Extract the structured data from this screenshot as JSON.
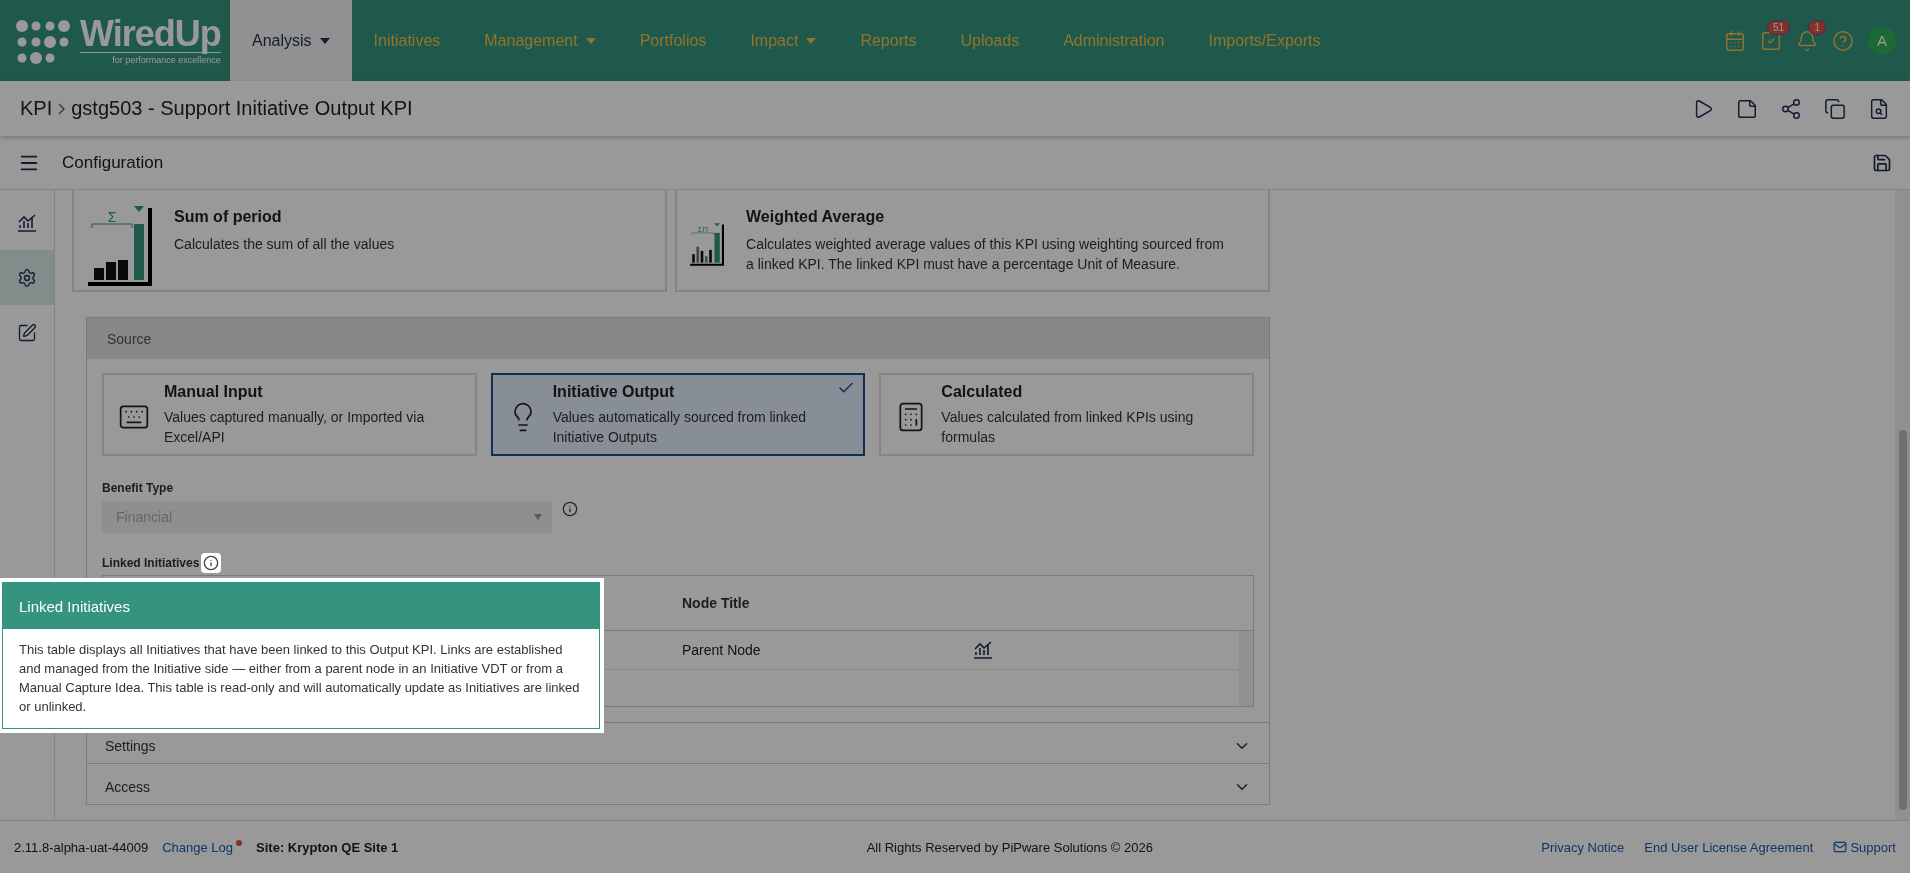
{
  "logo": {
    "name": "WiredUp",
    "tagline": "for performance excellence"
  },
  "nav": [
    {
      "label": "Analysis",
      "selected": true,
      "dropdown": true
    },
    {
      "label": "Initiatives",
      "selected": false,
      "dropdown": false
    },
    {
      "label": "Management",
      "selected": false,
      "dropdown": true
    },
    {
      "label": "Portfolios",
      "selected": false,
      "dropdown": false
    },
    {
      "label": "Impact",
      "selected": false,
      "dropdown": true
    },
    {
      "label": "Reports",
      "selected": false,
      "dropdown": false
    },
    {
      "label": "Uploads",
      "selected": false,
      "dropdown": false
    },
    {
      "label": "Administration",
      "selected": false,
      "dropdown": false
    },
    {
      "label": "Imports/Exports",
      "selected": false,
      "dropdown": false
    }
  ],
  "header_actions": [
    {
      "kind": "calendar"
    },
    {
      "kind": "tasks",
      "badge": "51"
    },
    {
      "kind": "bell",
      "badge": "1"
    },
    {
      "kind": "help"
    }
  ],
  "avatar": "A",
  "breadcrumb": [
    "KPI",
    "gstg503 - Support Initiative Output KPI"
  ],
  "page_actions": [
    {
      "kind": "play"
    },
    {
      "kind": "note"
    },
    {
      "kind": "network"
    },
    {
      "kind": "copy"
    },
    {
      "kind": "search"
    }
  ],
  "section_title": "Configuration",
  "sidebar": [
    {
      "kind": "chart",
      "selected": false
    },
    {
      "kind": "settings",
      "selected": true
    },
    {
      "kind": "edit",
      "selected": false
    }
  ],
  "aggregations": [
    {
      "kind": "sum",
      "symbol": "Σ",
      "title": "Sum of period",
      "description": "Calculates the sum of all the values"
    },
    {
      "kind": "weighted",
      "symbol": "ΣΠ",
      "title": "Weighted Average",
      "description": "Calculates weighted average values of this KPI using weighting sourced from a linked KPI. The linked KPI must have a percentage Unit of Measure."
    }
  ],
  "source": {
    "title": "Source",
    "options": [
      {
        "kind": "keyboard",
        "title": "Manual Input",
        "description": "Values captured manually, or Imported via Excel/API",
        "selected": false
      },
      {
        "kind": "bulb",
        "title": "Initiative Output",
        "description": "Values automatically sourced from linked Initiative Outputs",
        "selected": true
      },
      {
        "kind": "calculator",
        "title": "Calculated",
        "description": "Values calculated from linked KPIs using formulas",
        "selected": false
      }
    ],
    "benefit_type": {
      "label": "Benefit Type",
      "value": "Financial",
      "disabled": true
    },
    "linked_label": "Linked Initiatives",
    "table": {
      "columns": [
        "Node Title"
      ],
      "rows": [
        {
          "node_title": "Parent Node"
        }
      ]
    }
  },
  "sections": [
    {
      "title": "Settings",
      "expanded": false
    },
    {
      "title": "Access",
      "expanded": false
    }
  ],
  "tooltip": {
    "title": "Linked Initiatives",
    "body": "This table displays all Initiatives that have been linked to this Output KPI. Links are established and managed from the Initiative side — either from a parent node in an Initiative VDT or from a Manual Capture Idea. This table is read-only and will automatically update as Initiatives are linked or unlinked."
  },
  "footer": {
    "version": "2.11.8-alpha-uat-44009",
    "change_log": "Change Log",
    "change_log_new": true,
    "site": "Site: Krypton QE Site 1",
    "copyright": "All Rights Reserved by PiPware Solutions © 2026",
    "links": [
      "Privacy Notice",
      "End User License Agreement",
      "Support"
    ]
  }
}
